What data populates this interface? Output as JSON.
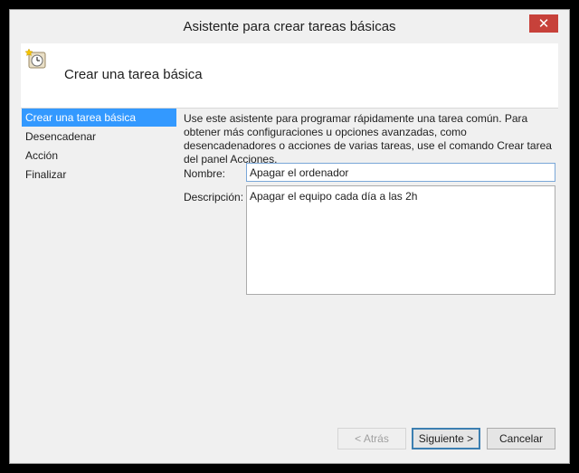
{
  "window": {
    "title": "Asistente para crear tareas básicas",
    "close_glyph": "✕"
  },
  "header": {
    "icon": "task-scheduler-icon",
    "title": "Crear una tarea básica"
  },
  "steps": [
    {
      "label": "Crear una tarea básica",
      "active": true
    },
    {
      "label": "Desencadenar",
      "active": false
    },
    {
      "label": "Acción",
      "active": false
    },
    {
      "label": "Finalizar",
      "active": false
    }
  ],
  "form": {
    "intro": "Use este asistente para programar rápidamente una tarea común. Para obtener más configuraciones u opciones avanzadas, como desencadenadores o acciones de varias tareas, use el comando Crear tarea del panel Acciones.",
    "name_label": "Nombre:",
    "name_value": "Apagar el ordenador",
    "description_label": "Descripción:",
    "description_value": "Apagar el equipo cada día a las 2h"
  },
  "buttons": {
    "back": "< Atrás",
    "next": "Siguiente >",
    "cancel": "Cancelar"
  },
  "colors": {
    "selection": "#3399ff",
    "close_button": "#c7413a",
    "focus_border": "#7aa7d8"
  }
}
